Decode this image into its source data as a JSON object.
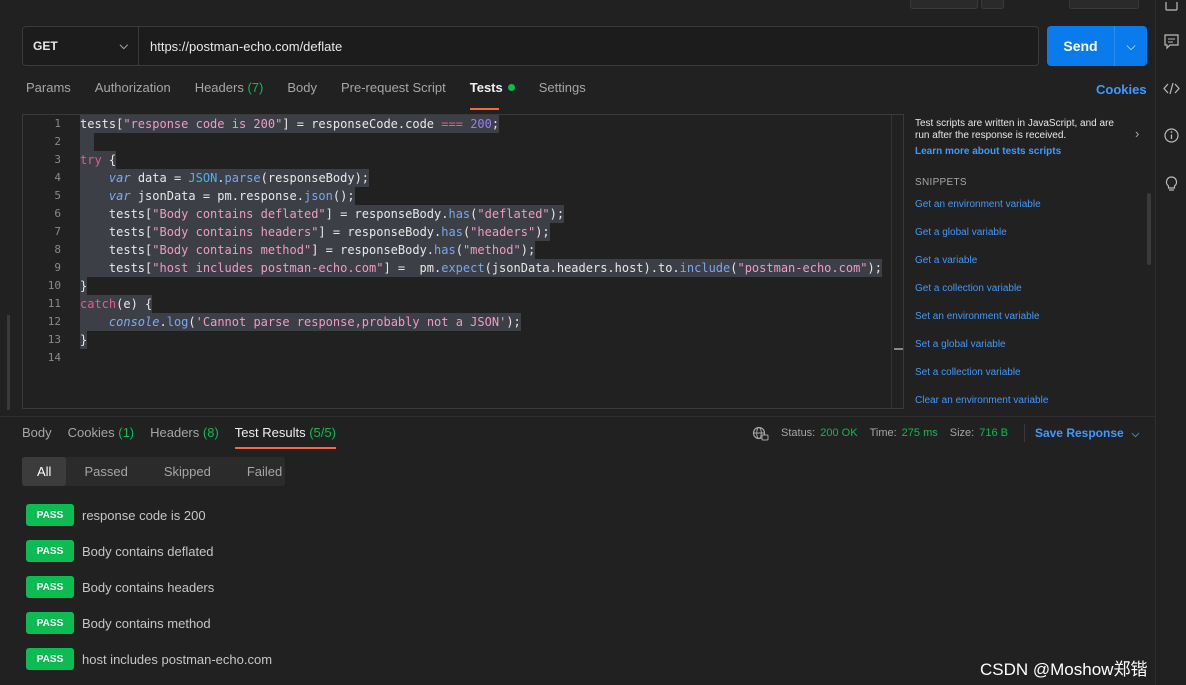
{
  "request": {
    "method": "GET",
    "url": "https://postman-echo.com/deflate",
    "send_label": "Send"
  },
  "request_tabs": [
    {
      "label": "Params"
    },
    {
      "label": "Authorization"
    },
    {
      "label": "Headers",
      "count": "(7)"
    },
    {
      "label": "Body"
    },
    {
      "label": "Pre-request Script"
    },
    {
      "label": "Tests",
      "active": true
    },
    {
      "label": "Settings"
    }
  ],
  "cookies_link": "Cookies",
  "editor": {
    "line_numbers": [
      "1",
      "2",
      "3",
      "4",
      "5",
      "6",
      "7",
      "8",
      "9",
      "10",
      "11",
      "12",
      "13",
      "14"
    ]
  },
  "snippets": {
    "intro": "Test scripts are written in JavaScript, and are run after the response is received.",
    "learn_more": "Learn more about tests scripts",
    "heading": "SNIPPETS",
    "items": [
      "Get an environment variable",
      "Get a global variable",
      "Get a variable",
      "Get a collection variable",
      "Set an environment variable",
      "Set a global variable",
      "Set a collection variable",
      "Clear an environment variable"
    ]
  },
  "response_tabs": [
    {
      "label": "Body"
    },
    {
      "label": "Cookies",
      "count": "(1)"
    },
    {
      "label": "Headers",
      "count": "(8)"
    },
    {
      "label": "Test Results",
      "count": "(5/5)",
      "active": true
    }
  ],
  "status": {
    "status_label": "Status:",
    "status_value": "200 OK",
    "time_label": "Time:",
    "time_value": "275 ms",
    "size_label": "Size:",
    "size_value": "716 B",
    "save_response": "Save Response"
  },
  "filters": [
    "All",
    "Passed",
    "Skipped",
    "Failed"
  ],
  "results": [
    {
      "badge": "PASS",
      "name": "response code is 200"
    },
    {
      "badge": "PASS",
      "name": "Body contains deflated"
    },
    {
      "badge": "PASS",
      "name": "Body contains headers"
    },
    {
      "badge": "PASS",
      "name": "Body contains method"
    },
    {
      "badge": "PASS",
      "name": "host includes postman-echo.com"
    }
  ],
  "watermark": "CSDN @Moshow郑锴",
  "colors": {
    "accent_blue": "#097bed",
    "pass_green": "#0cbb52",
    "tab_underline": "#f26b3a"
  }
}
